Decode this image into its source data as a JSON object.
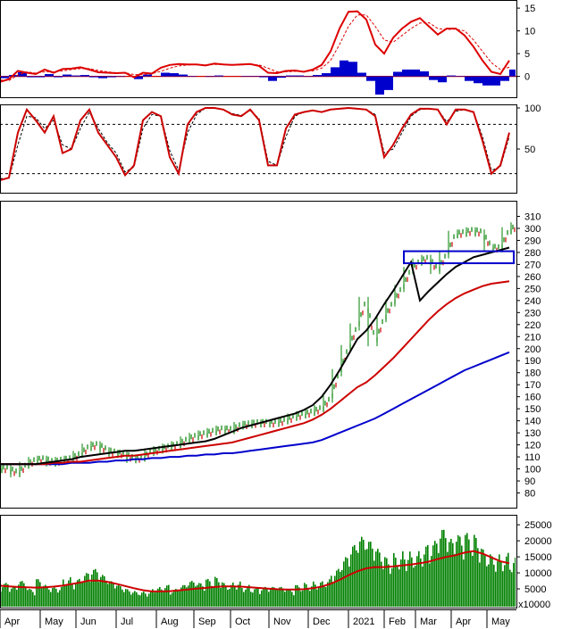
{
  "chart_data": [
    {
      "type": "line",
      "panel": "macd",
      "title": "",
      "ylim": [
        -4,
        16
      ],
      "yticks": [
        "15",
        "10",
        "5",
        "0"
      ],
      "yvals": [
        15,
        10,
        5,
        0
      ],
      "x": [
        0,
        10,
        20,
        30,
        40,
        50,
        60,
        70,
        80,
        90,
        100,
        110,
        120,
        130,
        140,
        150,
        160,
        170,
        180,
        190,
        200,
        210,
        220,
        230,
        240,
        250,
        260,
        270,
        280,
        290,
        300,
        310,
        320,
        330,
        340,
        350,
        360,
        370,
        380,
        390,
        400,
        410,
        420,
        430,
        440,
        450,
        460,
        470,
        480,
        490,
        500,
        510,
        520,
        530,
        540,
        550,
        560,
        570
      ],
      "series": [
        {
          "color": "#dd0000",
          "values": [
            -1.2,
            -0.6,
            1.2,
            0.8,
            0.5,
            1.5,
            0.8,
            1.6,
            1.7,
            2.0,
            1.5,
            0.9,
            0.8,
            0.7,
            0.8,
            -0.2,
            0.8,
            0.6,
            1.9,
            2.5,
            2.7,
            2.6,
            2.6,
            2.4,
            2.8,
            2.6,
            2.5,
            2.6,
            2.7,
            2.3,
            0.8,
            0.7,
            1.2,
            1.3,
            1.0,
            1.5,
            2.5,
            5.5,
            10.5,
            14.2,
            14.3,
            12.5,
            7.0,
            5.0,
            8.5,
            10.5,
            12.0,
            12.8,
            11.0,
            9.2,
            10.5,
            10.5,
            9.0,
            6.5,
            3.5,
            1.0,
            0.5,
            3.5
          ]
        },
        {
          "color": "#dd0000",
          "dashed": true,
          "values": [
            -0.8,
            -0.9,
            0.3,
            1.0,
            0.7,
            1.0,
            1.0,
            1.2,
            1.5,
            1.7,
            1.7,
            1.3,
            1.0,
            0.8,
            0.8,
            0.4,
            0.4,
            0.6,
            1.1,
            1.8,
            2.3,
            2.5,
            2.6,
            2.5,
            2.6,
            2.6,
            2.5,
            2.5,
            2.6,
            2.5,
            1.8,
            1.0,
            1.0,
            1.1,
            1.1,
            1.2,
            1.8,
            3.5,
            7.0,
            11.0,
            13.5,
            13.5,
            11.0,
            8.0,
            7.5,
            9.0,
            10.5,
            11.7,
            11.8,
            10.5,
            10.3,
            10.4,
            10.0,
            8.0,
            5.5,
            3.0,
            1.5,
            2.0
          ]
        },
        {
          "type": "histogram",
          "color": "#0000cc",
          "values": [
            -0.4,
            0.3,
            0.9,
            -0.2,
            -0.2,
            0.5,
            -0.2,
            0.4,
            0.2,
            0.3,
            -0.2,
            -0.4,
            -0.2,
            -0.1,
            0,
            -0.6,
            0.4,
            0,
            0.8,
            0.7,
            0.4,
            0.1,
            0,
            -0.1,
            0.2,
            0,
            0,
            0.1,
            0.1,
            -0.2,
            -1.0,
            -0.3,
            0.2,
            0.2,
            -0.1,
            0.3,
            0.7,
            2.0,
            3.5,
            3.2,
            0.8,
            -1.0,
            -4.0,
            -3.0,
            1.0,
            1.5,
            1.5,
            1.1,
            -0.8,
            -1.3,
            0.2,
            0.1,
            -1.0,
            -1.5,
            -2.0,
            -2.0,
            -1.0,
            1.5
          ]
        }
      ]
    },
    {
      "type": "line",
      "panel": "stochastic",
      "title": "",
      "ylim": [
        0,
        100
      ],
      "yticks": [
        "100",
        "50"
      ],
      "yvals": [
        100,
        50
      ],
      "reference_lines": [
        80,
        20
      ],
      "x": [
        0,
        10,
        20,
        30,
        40,
        50,
        60,
        70,
        80,
        90,
        100,
        110,
        120,
        130,
        140,
        150,
        160,
        170,
        180,
        190,
        200,
        210,
        220,
        230,
        240,
        250,
        260,
        270,
        280,
        290,
        300,
        310,
        320,
        330,
        340,
        350,
        360,
        370,
        380,
        390,
        400,
        410,
        420,
        430,
        440,
        450,
        460,
        470,
        480,
        490,
        500,
        510,
        520,
        530,
        540,
        550,
        560,
        570
      ],
      "series": [
        {
          "color": "#cc0000",
          "values": [
            12,
            15,
            70,
            98,
            85,
            70,
            90,
            45,
            50,
            85,
            98,
            70,
            55,
            40,
            18,
            30,
            85,
            95,
            90,
            40,
            20,
            80,
            95,
            100,
            100,
            98,
            92,
            90,
            98,
            85,
            30,
            30,
            75,
            92,
            95,
            97,
            95,
            98,
            99,
            100,
            99,
            98,
            90,
            40,
            55,
            75,
            92,
            99,
            99,
            98,
            80,
            98,
            98,
            95,
            60,
            20,
            30,
            70
          ]
        },
        {
          "color": "#000000",
          "dashed": true,
          "values": [
            14,
            14,
            55,
            90,
            88,
            75,
            85,
            55,
            50,
            75,
            95,
            75,
            58,
            45,
            22,
            28,
            75,
            92,
            90,
            48,
            24,
            70,
            92,
            100,
            100,
            98,
            93,
            91,
            97,
            87,
            35,
            30,
            65,
            90,
            95,
            97,
            95,
            98,
            99,
            100,
            99,
            98,
            92,
            45,
            50,
            70,
            90,
            98,
            99,
            98,
            83,
            96,
            98,
            95,
            65,
            24,
            28,
            65
          ]
        }
      ]
    },
    {
      "type": "line",
      "panel": "price",
      "title": "",
      "ylim": [
        70,
        320
      ],
      "yticks": [
        "310",
        "300",
        "290",
        "280",
        "270",
        "260",
        "250",
        "240",
        "230",
        "220",
        "210",
        "200",
        "190",
        "180",
        "170",
        "160",
        "150",
        "140",
        "130",
        "120",
        "110",
        "100",
        "90",
        "80"
      ],
      "yvals": [
        310,
        300,
        290,
        280,
        270,
        260,
        250,
        240,
        230,
        220,
        210,
        200,
        190,
        180,
        170,
        160,
        150,
        140,
        130,
        120,
        110,
        100,
        90,
        80
      ],
      "x": [
        0,
        10,
        20,
        30,
        40,
        50,
        60,
        70,
        80,
        90,
        100,
        110,
        120,
        130,
        140,
        150,
        160,
        170,
        180,
        190,
        200,
        210,
        220,
        230,
        240,
        250,
        260,
        270,
        280,
        290,
        300,
        310,
        320,
        330,
        340,
        350,
        360,
        370,
        380,
        390,
        400,
        410,
        420,
        430,
        440,
        450,
        460,
        470,
        480,
        490,
        500,
        510,
        520,
        530,
        540,
        550,
        560,
        570
      ],
      "series": [
        {
          "name": "",
          "color": "#008000",
          "values": [
            100,
            96,
            103,
            107,
            108,
            105,
            107,
            108,
            112,
            118,
            120,
            115,
            113,
            112,
            108,
            109,
            114,
            116,
            118,
            120,
            124,
            127,
            129,
            131,
            133,
            132,
            136,
            137,
            138,
            138,
            138,
            140,
            143,
            145,
            147,
            150,
            158,
            180,
            200,
            218,
            240,
            205,
            225,
            238,
            250,
            265,
            272,
            275,
            265,
            278,
            295,
            296,
            298,
            296,
            284,
            283,
            298,
            302
          ]
        },
        {
          "name": "",
          "color": "#000000",
          "values": [
            104,
            104,
            104,
            104,
            104,
            105,
            106,
            107,
            108,
            110,
            111,
            112,
            113,
            114,
            115,
            115,
            116,
            117,
            118,
            119,
            120,
            121,
            122,
            123,
            125,
            128,
            131,
            134,
            136,
            138,
            140,
            142,
            144,
            146,
            149,
            153,
            160,
            170,
            182,
            195,
            208,
            215,
            225,
            237,
            248,
            260,
            272,
            240,
            248,
            255,
            262,
            268,
            272,
            276,
            278,
            280,
            282,
            284
          ]
        },
        {
          "name": "",
          "color": "#cc0000",
          "values": [
            104,
            104,
            104,
            104,
            104,
            104,
            105,
            105,
            106,
            106,
            107,
            108,
            109,
            110,
            111,
            111,
            112,
            113,
            114,
            115,
            116,
            117,
            118,
            119,
            120,
            121,
            122,
            124,
            126,
            128,
            130,
            132,
            134,
            136,
            138,
            141,
            145,
            150,
            156,
            162,
            168,
            172,
            178,
            185,
            192,
            200,
            208,
            216,
            224,
            231,
            237,
            242,
            246,
            249,
            252,
            254,
            255,
            256
          ]
        },
        {
          "name": "",
          "color": "#0000cc",
          "values": [
            104,
            104,
            104,
            104,
            104,
            104,
            104,
            104,
            105,
            105,
            105,
            106,
            106,
            107,
            107,
            108,
            108,
            109,
            109,
            110,
            110,
            111,
            111,
            112,
            112,
            113,
            113,
            114,
            115,
            116,
            117,
            118,
            119,
            120,
            121,
            122,
            124,
            127,
            130,
            133,
            136,
            139,
            142,
            146,
            150,
            154,
            158,
            162,
            166,
            170,
            174,
            178,
            182,
            185,
            188,
            191,
            194,
            197
          ]
        }
      ],
      "annotation": {
        "shape": "rectangle",
        "color": "#0000cc",
        "price_range": [
          271,
          281
        ],
        "x_range": [
          452,
          575
        ]
      }
    },
    {
      "type": "bar",
      "panel": "volume",
      "title": "",
      "ylim": [
        0,
        27000
      ],
      "yticks": [
        "25000",
        "20000",
        "15000",
        "10000",
        "5000"
      ],
      "yvals": [
        25000,
        20000,
        15000,
        10000,
        5000
      ],
      "units_label": "x10000",
      "x": [
        0,
        10,
        20,
        30,
        40,
        50,
        60,
        70,
        80,
        90,
        100,
        110,
        120,
        130,
        140,
        150,
        160,
        170,
        180,
        190,
        200,
        210,
        220,
        230,
        240,
        250,
        260,
        270,
        280,
        290,
        300,
        310,
        320,
        330,
        340,
        350,
        360,
        370,
        380,
        390,
        400,
        410,
        420,
        430,
        440,
        450,
        460,
        470,
        480,
        490,
        500,
        510,
        520,
        530,
        540,
        550,
        560,
        570
      ],
      "series": [
        {
          "name": "",
          "color": "#008000",
          "values": [
            5500,
            4500,
            6000,
            4000,
            6500,
            5000,
            4800,
            7000,
            6500,
            8000,
            9000,
            7500,
            6000,
            5000,
            4000,
            3500,
            3500,
            4500,
            5000,
            4000,
            5000,
            6000,
            5500,
            6500,
            7000,
            5500,
            6000,
            5000,
            4500,
            4500,
            4500,
            4500,
            4000,
            5000,
            5500,
            6000,
            6500,
            9000,
            12000,
            15000,
            17000,
            16000,
            14000,
            12000,
            13000,
            14000,
            13500,
            15000,
            16000,
            19000,
            16500,
            17500,
            18000,
            17500,
            14000,
            13000,
            13000,
            12000
          ]
        },
        {
          "name": "",
          "color": "#cc0000",
          "type": "line",
          "values": [
            6000,
            5800,
            5600,
            5500,
            5400,
            5500,
            5700,
            6000,
            6500,
            7000,
            7600,
            7600,
            7200,
            6600,
            5900,
            5200,
            4600,
            4200,
            4200,
            4300,
            4500,
            4800,
            5100,
            5300,
            5600,
            5800,
            5800,
            5700,
            5500,
            5300,
            5100,
            4900,
            4800,
            4800,
            4900,
            5200,
            5700,
            6600,
            7800,
            9200,
            10500,
            11400,
            11800,
            11800,
            12000,
            12300,
            12600,
            13000,
            13500,
            14300,
            15000,
            15500,
            16300,
            16800,
            16000,
            14800,
            13600,
            13000
          ]
        }
      ]
    }
  ],
  "x_axis": {
    "months": [
      "Apr",
      "May",
      "Jun",
      "Jul",
      "Aug",
      "Sep",
      "Oct",
      "Nov",
      "Dec",
      "2021",
      "Feb",
      "Mar",
      "Apr",
      "May"
    ]
  },
  "colors": {
    "macd": "#dd0000",
    "histogram": "#0000cc",
    "price_up": "#008000",
    "ma_fast": "#000000",
    "ma_mid": "#cc0000",
    "ma_slow": "#0000cc",
    "volume": "#008000"
  }
}
